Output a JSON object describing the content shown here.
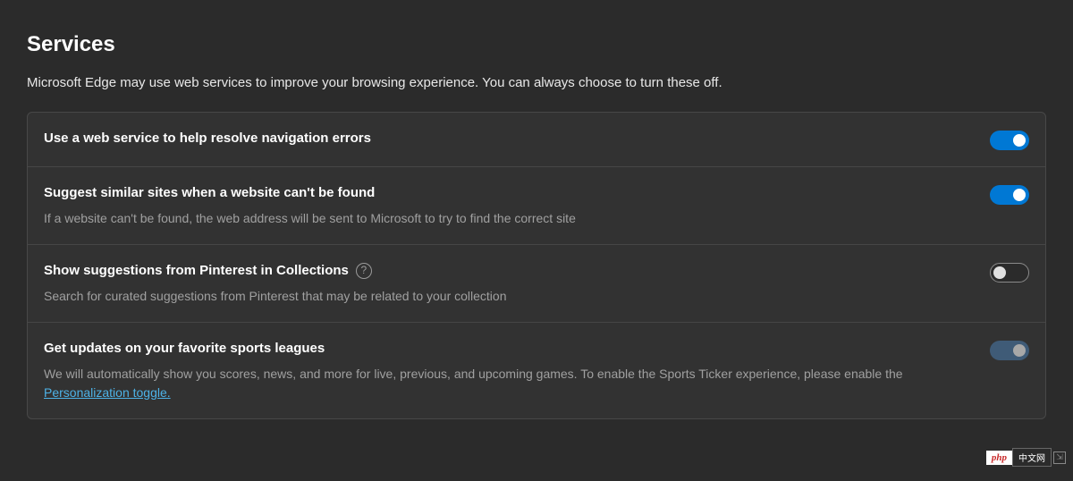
{
  "section": {
    "title": "Services",
    "description": "Microsoft Edge may use web services to improve your browsing experience. You can always choose to turn these off."
  },
  "settings": [
    {
      "label": "Use a web service to help resolve navigation errors",
      "sublabel": "",
      "help": false,
      "toggle": "on"
    },
    {
      "label": "Suggest similar sites when a website can't be found",
      "sublabel": "If a website can't be found, the web address will be sent to Microsoft to try to find the correct site",
      "help": false,
      "toggle": "on"
    },
    {
      "label": "Show suggestions from Pinterest in Collections",
      "sublabel": "Search for curated suggestions from Pinterest that may be related to your collection",
      "help": true,
      "toggle": "off"
    },
    {
      "label": "Get updates on your favorite sports leagues",
      "sublabel_prefix": "We will automatically show you scores, news, and more for live, previous, and upcoming games. To enable the Sports Ticker experience, please enable the ",
      "link_text": "Personalization toggle.",
      "help": false,
      "toggle": "dim"
    }
  ],
  "watermark": {
    "php": "php",
    "cn": "中文网"
  }
}
